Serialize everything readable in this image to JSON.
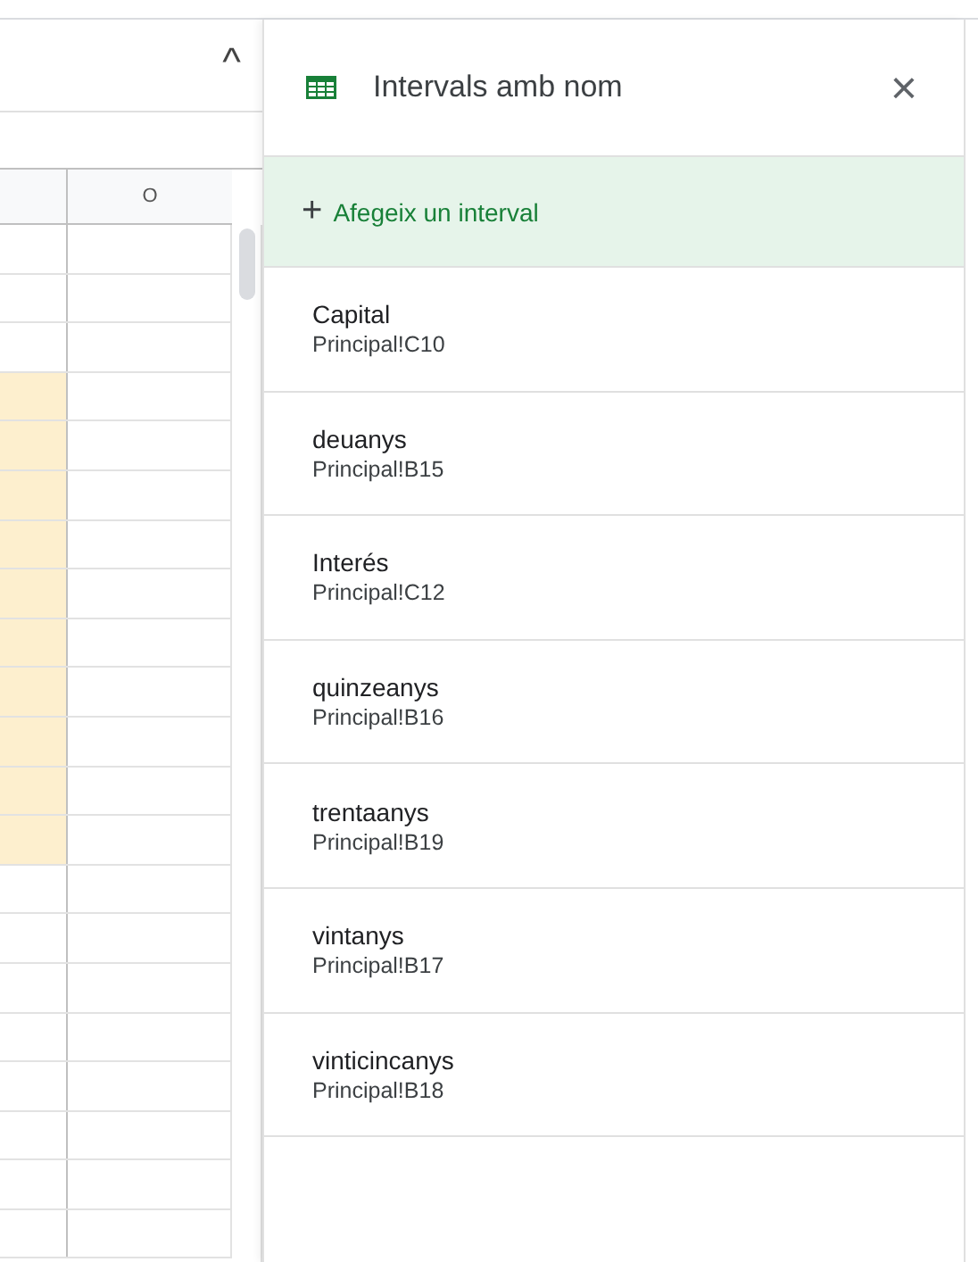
{
  "sheet": {
    "collapse_icon": "^",
    "column_header": "O",
    "rows": [
      {
        "highlighted": false
      },
      {
        "highlighted": false
      },
      {
        "highlighted": false
      },
      {
        "highlighted": true
      },
      {
        "highlighted": true
      },
      {
        "highlighted": true
      },
      {
        "highlighted": true
      },
      {
        "highlighted": true
      },
      {
        "highlighted": true
      },
      {
        "highlighted": true
      },
      {
        "highlighted": true
      },
      {
        "highlighted": true
      },
      {
        "highlighted": true
      },
      {
        "highlighted": false
      },
      {
        "highlighted": false
      },
      {
        "highlighted": false
      },
      {
        "highlighted": false
      },
      {
        "highlighted": false
      },
      {
        "highlighted": false
      },
      {
        "highlighted": false
      },
      {
        "highlighted": false
      }
    ]
  },
  "panel": {
    "title": "Intervals amb nom",
    "close": "×",
    "add_button": {
      "icon": "+",
      "label": "Afegeix un interval"
    },
    "ranges": [
      {
        "name": "Capital",
        "reference": "Principal!C10"
      },
      {
        "name": "deuanys",
        "reference": "Principal!B15"
      },
      {
        "name": "Interés",
        "reference": "Principal!C12"
      },
      {
        "name": "quinzeanys",
        "reference": "Principal!B16"
      },
      {
        "name": "trentaanys",
        "reference": "Principal!B19"
      },
      {
        "name": "vintanys",
        "reference": "Principal!B17"
      },
      {
        "name": "vinticincanys",
        "reference": "Principal!B18"
      }
    ]
  }
}
